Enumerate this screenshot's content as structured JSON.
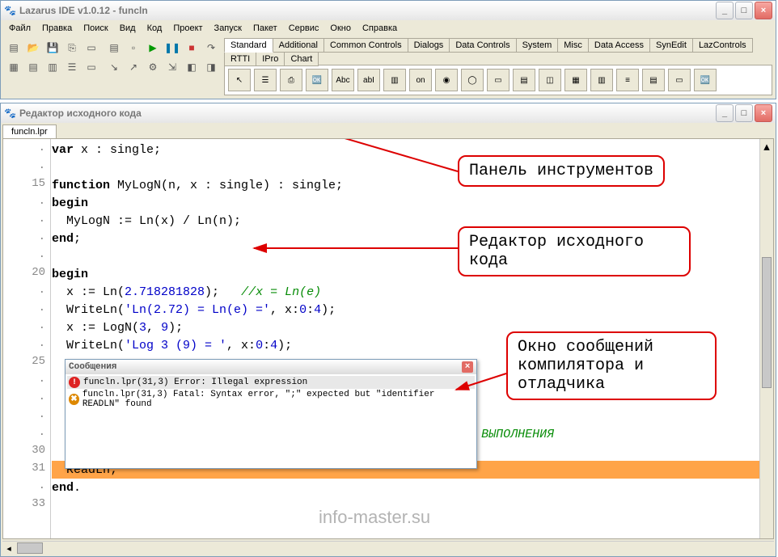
{
  "mainWindow": {
    "title": "Lazarus IDE v1.0.12 - funcln"
  },
  "menus": [
    "Файл",
    "Правка",
    "Поиск",
    "Вид",
    "Код",
    "Проект",
    "Запуск",
    "Пакет",
    "Сервис",
    "Окно",
    "Справка"
  ],
  "componentTabs": [
    "Standard",
    "Additional",
    "Common Controls",
    "Dialogs",
    "Data Controls",
    "System",
    "Misc",
    "Data Access",
    "SynEdit",
    "LazControls",
    "RTTI",
    "IPro",
    "Chart"
  ],
  "paletteIcons": [
    "↖",
    "☰",
    "⎙",
    "🆗",
    "Abc",
    "abI",
    "▥",
    "on",
    "◉",
    "◯",
    "▭",
    "▤",
    "◫",
    "▦",
    "▥",
    "≡",
    "▤",
    "▭",
    "🆗"
  ],
  "editorWindow": {
    "title": "Редактор исходного кода",
    "fileTab": "funcln.lpr"
  },
  "gutter": [
    ".",
    ".",
    "15",
    ".",
    ".",
    ".",
    ".",
    "20",
    ".",
    ".",
    ".",
    ".",
    "25",
    ".",
    ".",
    ".",
    ".",
    "30",
    "31",
    ".",
    "33"
  ],
  "code": [
    {
      "t": [
        {
          "c": "kw",
          "v": "var"
        },
        {
          "c": "",
          "v": " x : single;"
        }
      ]
    },
    {
      "t": []
    },
    {
      "t": [
        {
          "c": "kw",
          "v": "function"
        },
        {
          "c": "",
          "v": " MyLogN(n, x : single) : single;"
        }
      ]
    },
    {
      "t": [
        {
          "c": "kw",
          "v": "begin"
        }
      ]
    },
    {
      "t": [
        {
          "c": "",
          "v": "  MyLogN := Ln(x) / Ln(n);"
        }
      ]
    },
    {
      "t": [
        {
          "c": "kw",
          "v": "end"
        },
        {
          "c": "",
          "v": ";"
        }
      ]
    },
    {
      "t": []
    },
    {
      "t": [
        {
          "c": "kw",
          "v": "begin"
        }
      ]
    },
    {
      "t": [
        {
          "c": "",
          "v": "  x := Ln("
        },
        {
          "c": "num",
          "v": "2.718281828"
        },
        {
          "c": "",
          "v": ");   "
        },
        {
          "c": "cmt",
          "v": "//x = Ln(e)"
        }
      ]
    },
    {
      "t": [
        {
          "c": "",
          "v": "  WriteLn("
        },
        {
          "c": "str",
          "v": "'Ln(2.72) = Ln(e) ='"
        },
        {
          "c": "",
          "v": ", x:"
        },
        {
          "c": "num",
          "v": "0"
        },
        {
          "c": "",
          "v": ":"
        },
        {
          "c": "num",
          "v": "4"
        },
        {
          "c": "",
          "v": ");"
        }
      ]
    },
    {
      "t": [
        {
          "c": "",
          "v": "  x := LogN("
        },
        {
          "c": "num",
          "v": "3"
        },
        {
          "c": "",
          "v": ", "
        },
        {
          "c": "num",
          "v": "9"
        },
        {
          "c": "",
          "v": ");"
        }
      ]
    },
    {
      "t": [
        {
          "c": "",
          "v": "  WriteLn("
        },
        {
          "c": "str",
          "v": "'Log 3 (9) = '"
        },
        {
          "c": "",
          "v": ", x:"
        },
        {
          "c": "num",
          "v": "0"
        },
        {
          "c": "",
          "v": ":"
        },
        {
          "c": "num",
          "v": "4"
        },
        {
          "c": "",
          "v": ");"
        }
      ]
    },
    {
      "t": []
    },
    {
      "t": []
    },
    {
      "t": []
    },
    {
      "t": []
    },
    {
      "t": [
        {
          "c": "cmt",
          "v": "                                                        НИ ВЫПОЛНЕНИЯ"
        }
      ]
    },
    {
      "t": []
    },
    {
      "hl": true,
      "t": [
        {
          "c": "",
          "v": "  ReadLn;"
        }
      ]
    },
    {
      "t": [
        {
          "c": "kw",
          "v": "end"
        },
        {
          "c": "",
          "v": "."
        }
      ]
    },
    {
      "t": []
    }
  ],
  "messages": {
    "title": "Сообщения",
    "items": [
      {
        "icon": "err",
        "text": "funcln.lpr(31,3) Error: Illegal expression",
        "sel": true
      },
      {
        "icon": "fat",
        "text": "funcln.lpr(31,3) Fatal: Syntax error, \";\" expected but \"identifier READLN\" found",
        "sel": false
      }
    ]
  },
  "callouts": {
    "c1": "Панель инструментов",
    "c2": "Редактор исходного кода",
    "c3": "Окно сообщений компилятора и отладчика"
  },
  "watermark": "info-master.su"
}
